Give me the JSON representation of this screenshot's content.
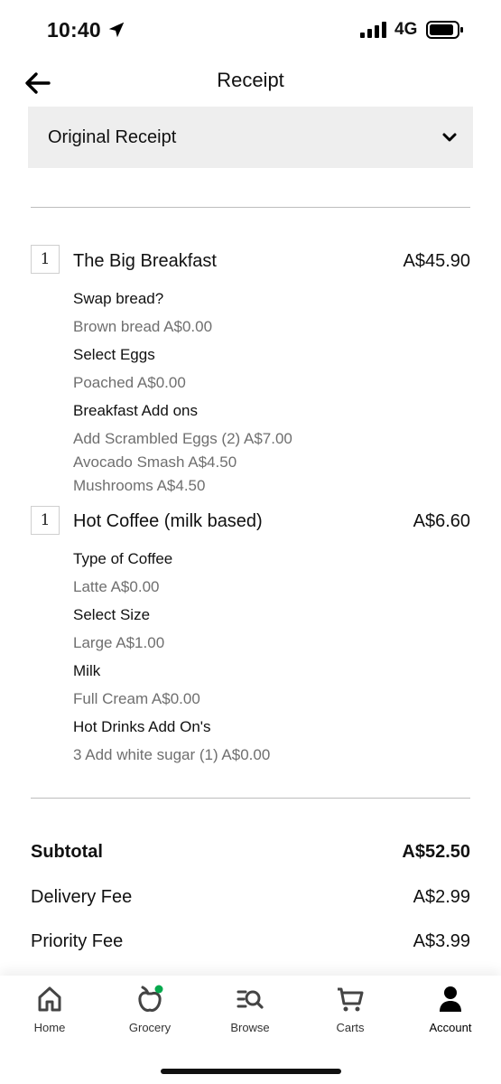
{
  "status_bar": {
    "time": "10:40",
    "network": "4G"
  },
  "header": {
    "title": "Receipt"
  },
  "receipt_selector": {
    "label": "Original Receipt"
  },
  "items": [
    {
      "qty": "1",
      "name": "The Big Breakfast",
      "price": "A$45.90",
      "options": [
        {
          "heading": "Swap bread?",
          "values": [
            "Brown bread A$0.00"
          ]
        },
        {
          "heading": "Select Eggs",
          "values": [
            "Poached A$0.00"
          ]
        },
        {
          "heading": "Breakfast Add ons",
          "values": [
            "Add Scrambled Eggs (2) A$7.00",
            "Avocado Smash A$4.50",
            "Mushrooms A$4.50"
          ]
        }
      ]
    },
    {
      "qty": "1",
      "name": "Hot Coffee (milk based)",
      "price": "A$6.60",
      "options": [
        {
          "heading": "Type of Coffee",
          "values": [
            "Latte A$0.00"
          ]
        },
        {
          "heading": "Select Size",
          "values": [
            "Large A$1.00"
          ]
        },
        {
          "heading": "Milk",
          "values": [
            "Full Cream A$0.00"
          ]
        },
        {
          "heading": "Hot Drinks Add On's",
          "values": [
            "3 Add white sugar (1) A$0.00"
          ]
        }
      ]
    }
  ],
  "summary": {
    "subtotal_label": "Subtotal",
    "subtotal_value": "A$52.50",
    "delivery_label": "Delivery Fee",
    "delivery_value": "A$2.99",
    "priority_label": "Priority Fee",
    "priority_value": "A$3.99"
  },
  "tabs": [
    {
      "label": "Home",
      "icon": "home-icon"
    },
    {
      "label": "Grocery",
      "icon": "grocery-icon"
    },
    {
      "label": "Browse",
      "icon": "browse-icon"
    },
    {
      "label": "Carts",
      "icon": "cart-icon"
    },
    {
      "label": "Account",
      "icon": "account-icon",
      "active": true
    }
  ],
  "colors": {
    "grocery_dot": "#06a94d",
    "muted_text": "#6f6f6f"
  }
}
